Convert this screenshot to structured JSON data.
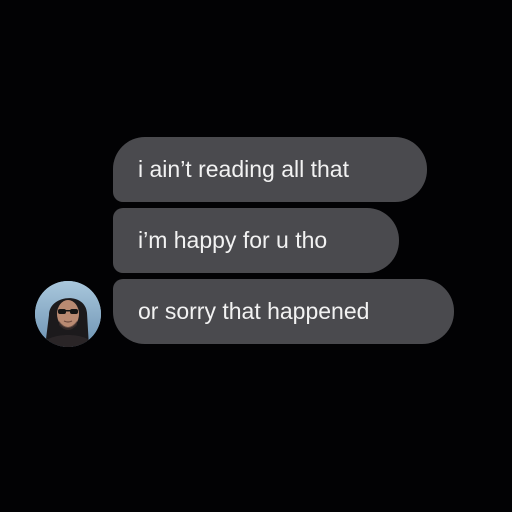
{
  "conversation": {
    "messages": [
      {
        "text": "i ain’t reading all that"
      },
      {
        "text": "i’m happy for u tho"
      },
      {
        "text": "or sorry that happened"
      }
    ]
  },
  "sender": {
    "avatar_icon": "person-with-sunglasses-avatar"
  },
  "colors": {
    "background": "#020204",
    "bubble": "#4a4a4e",
    "bubble_text": "#f2f2f2"
  }
}
